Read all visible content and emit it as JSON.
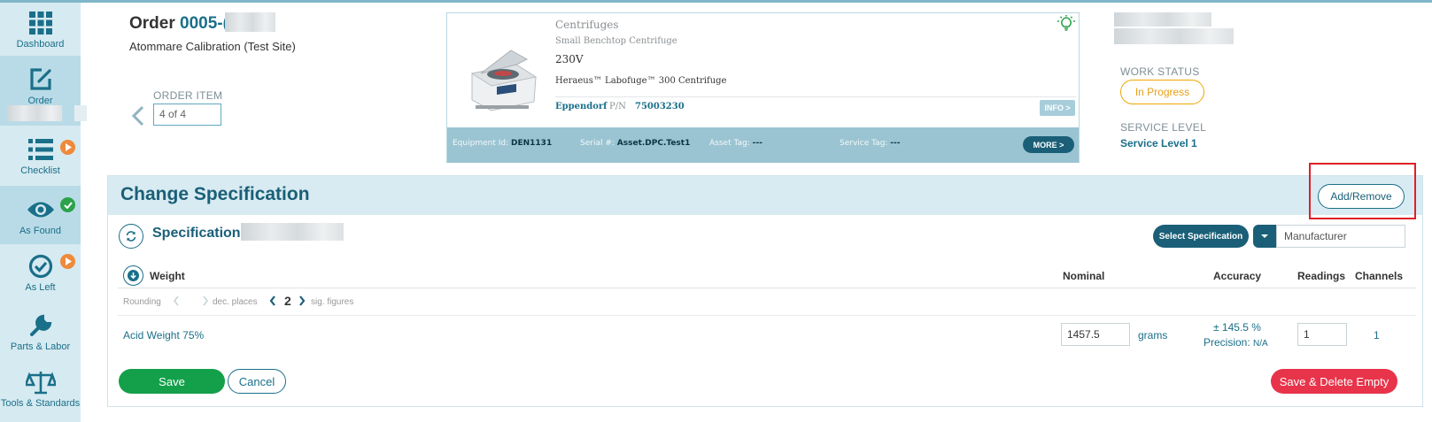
{
  "sidebar": {
    "items": [
      {
        "label": "Dashboard",
        "icon": "grid-icon"
      },
      {
        "label": "Order",
        "icon": "edit-icon",
        "active": true
      },
      {
        "label": "Checklist",
        "icon": "list-icon",
        "badge": "play"
      },
      {
        "label": "As Found",
        "icon": "eye-icon",
        "badge": "check",
        "active": true
      },
      {
        "label": "As Left",
        "icon": "check-circle-icon",
        "badge": "play"
      },
      {
        "label": "Parts & Labor",
        "icon": "wrench-icon"
      },
      {
        "label": "Tools & Standards",
        "icon": "scale-icon"
      }
    ]
  },
  "header": {
    "order_prefix": "Order ",
    "order_number": "0005-(",
    "site": "Atommare Calibration (Test Site)",
    "order_item_label": "ORDER ITEM",
    "order_item_value": "4 of 4"
  },
  "equipment": {
    "category": "Centrifuges",
    "subcategory": "Small Benchtop Centrifuge",
    "voltage": "230V",
    "model": "Heraeus™ Labofuge™ 300 Centrifuge",
    "brand": "Eppendorf",
    "pn_label": "P/N",
    "pn": "75003230",
    "info_label": "INFO >",
    "footer": {
      "equipment_id_label": "Equipment Id:",
      "equipment_id": "DEN1131",
      "serial_label": "Serial #:",
      "serial": "Asset.DPC.Test1",
      "asset_tag_label": "Asset Tag:",
      "asset_tag": "---",
      "service_tag_label": "Service Tag:",
      "service_tag": "---",
      "more_label": "MORE >"
    }
  },
  "status": {
    "work_status_label": "WORK STATUS",
    "work_status": "In Progress",
    "service_level_label": "SERVICE LEVEL",
    "service_level": "Service Level 1"
  },
  "panel": {
    "title": "Change Specification",
    "add_remove_label": "Add/Remove",
    "specification_label": "Specification",
    "select_spec_label": "Select Specification",
    "manufacturer_value": "Manufacturer",
    "columns": {
      "weight": "Weight",
      "nominal": "Nominal",
      "accuracy": "Accuracy",
      "readings": "Readings",
      "channels": "Channels"
    },
    "rounding": {
      "label": "Rounding",
      "dec_places_label": "dec. places",
      "sig_figures_value": "2",
      "sig_figures_label": "sig. figures"
    },
    "row": {
      "name": "Acid Weight 75%",
      "nominal": "1457.5",
      "unit": "grams",
      "accuracy": "± 145.5 %",
      "precision_label": "Precision:",
      "precision_value": "N/A",
      "readings": "1",
      "channels": "1"
    },
    "save_label": "Save",
    "cancel_label": "Cancel",
    "save_delete_label": "Save & Delete Empty"
  },
  "colors": {
    "primary": "#1a5f77",
    "sidebar_bg": "#d6eaf1",
    "save_green": "#14a04a",
    "danger_red": "#e8344a",
    "status_orange": "#f0a500"
  }
}
